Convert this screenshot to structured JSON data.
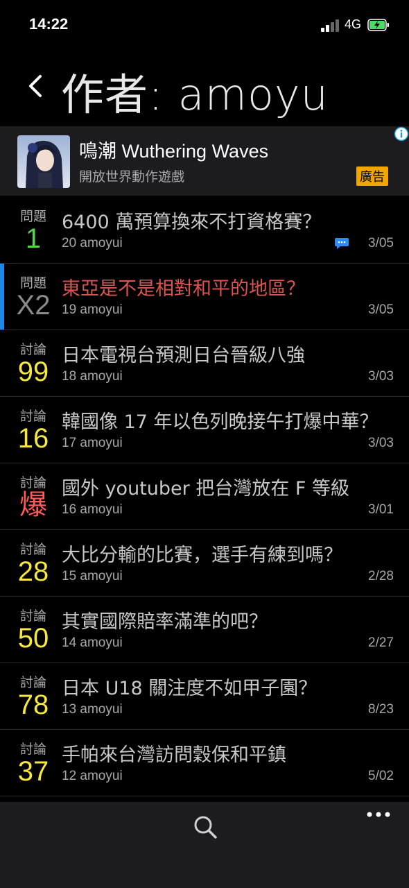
{
  "status": {
    "time": "14:22",
    "network": "4G"
  },
  "header": {
    "title": "作者: amoyu"
  },
  "ad": {
    "title": "鳴潮 Wuthering Waves",
    "subtitle": "開放世界動作遊戲",
    "badge": "廣告"
  },
  "posts": [
    {
      "category": "問題",
      "count": "1",
      "count_color": "#59d34d",
      "title": "6400 萬預算換來不打資格賽？",
      "meta": "20  amoyui",
      "date": "3/05",
      "title_color": "#c8c8c8",
      "has_comment_icon": true,
      "selected": false
    },
    {
      "category": "問題",
      "count": "X2",
      "count_color": "#8a8a8a",
      "title": "東亞是不是相對和平的地區？",
      "meta": "19  amoyui",
      "date": "3/05",
      "title_color": "#d9534f",
      "has_comment_icon": false,
      "selected": true
    },
    {
      "category": "討論",
      "count": "99",
      "count_color": "#f5e642",
      "title": "日本電視台預測日台晉級八強",
      "meta": "18  amoyui",
      "date": "3/03",
      "title_color": "#c8c8c8",
      "has_comment_icon": false,
      "selected": false
    },
    {
      "category": "討論",
      "count": "16",
      "count_color": "#f5e642",
      "title": "韓國像 17 年以色列晚接午打爆中華？",
      "meta": "17  amoyui",
      "date": "3/03",
      "title_color": "#c8c8c8",
      "has_comment_icon": false,
      "selected": false
    },
    {
      "category": "討論",
      "count": "爆",
      "count_color": "#ff5a5a",
      "title": "國外 youtuber 把台灣放在 F 等級",
      "meta": "16  amoyui",
      "date": "3/01",
      "title_color": "#c8c8c8",
      "has_comment_icon": false,
      "selected": false
    },
    {
      "category": "討論",
      "count": "28",
      "count_color": "#f5e642",
      "title": "大比分輸的比賽，選手有練到嗎？",
      "meta": "15  amoyui",
      "date": "2/28",
      "title_color": "#c8c8c8",
      "has_comment_icon": false,
      "selected": false
    },
    {
      "category": "討論",
      "count": "50",
      "count_color": "#f5e642",
      "title": "其實國際賠率滿準的吧？",
      "meta": "14  amoyui",
      "date": "2/27",
      "title_color": "#c8c8c8",
      "has_comment_icon": false,
      "selected": false
    },
    {
      "category": "討論",
      "count": "78",
      "count_color": "#f5e642",
      "title": "日本 U18 關注度不如甲子園？",
      "meta": "13  amoyui",
      "date": "8/23",
      "title_color": "#c8c8c8",
      "has_comment_icon": false,
      "selected": false
    },
    {
      "category": "討論",
      "count": "37",
      "count_color": "#f5e642",
      "title": "手帕來台灣訪問穀保和平鎮",
      "meta": "12  amoyui",
      "date": "5/02",
      "title_color": "#c8c8c8",
      "has_comment_icon": false,
      "selected": false
    }
  ],
  "colors": {
    "selected_bar": "#1e88e5",
    "ad_badge": "#f0a500"
  },
  "icons": {
    "back": "chevron-left-icon",
    "search": "search-icon",
    "more": "more-dots-icon",
    "comment": "comment-bubble-icon",
    "info": "info-icon"
  }
}
